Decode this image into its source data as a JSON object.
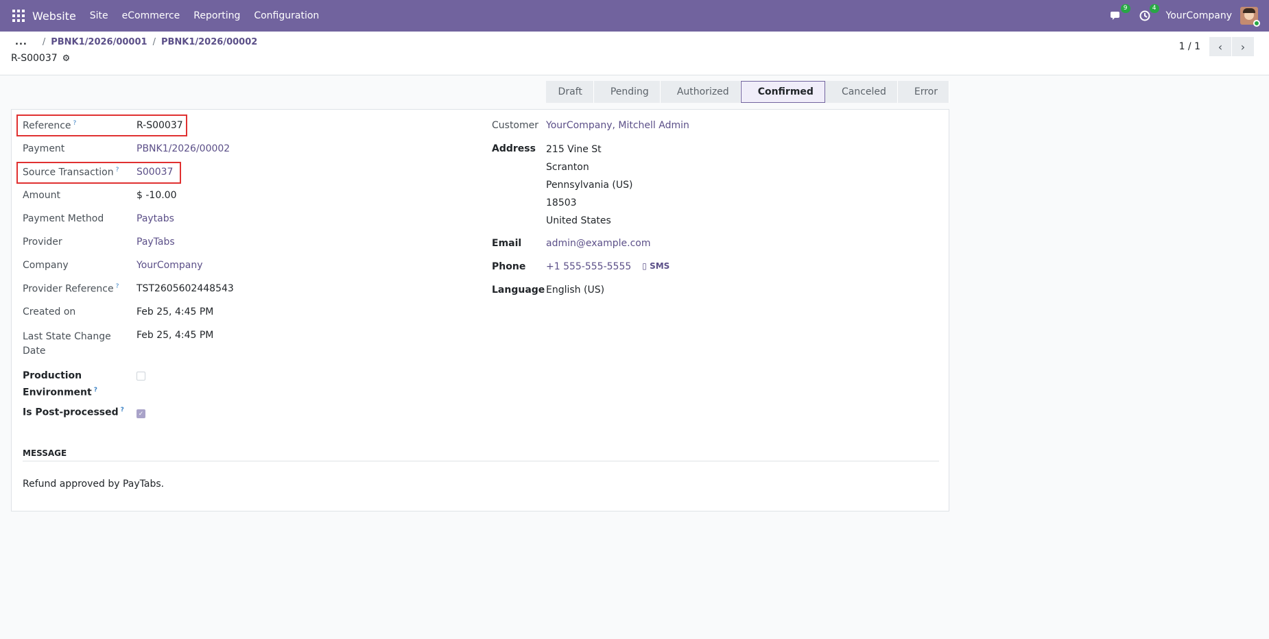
{
  "navbar": {
    "brand": "Website",
    "menu": [
      "Site",
      "eCommerce",
      "Reporting",
      "Configuration"
    ],
    "messages_count": "9",
    "activities_count": "4",
    "company": "YourCompany"
  },
  "breadcrumb": {
    "more": "...",
    "items": [
      "PBNK1/2026/00001",
      "PBNK1/2026/00002"
    ]
  },
  "record_title": "R-S00037",
  "pager": {
    "value": "1 / 1"
  },
  "statusbar": {
    "stages": [
      "Draft",
      "Pending",
      "Authorized",
      "Confirmed",
      "Canceled",
      "Error"
    ],
    "active": "Confirmed"
  },
  "left_fields": {
    "reference": {
      "label": "Reference",
      "value": "R-S00037"
    },
    "payment": {
      "label": "Payment",
      "value": "PBNK1/2026/00002"
    },
    "source_transaction": {
      "label": "Source Transaction",
      "value": "S00037"
    },
    "amount": {
      "label": "Amount",
      "value": "$ -10.00"
    },
    "payment_method": {
      "label": "Payment Method",
      "value": "Paytabs"
    },
    "provider": {
      "label": "Provider",
      "value": "PayTabs"
    },
    "company": {
      "label": "Company",
      "value": "YourCompany"
    },
    "provider_reference": {
      "label": "Provider Reference",
      "value": "TST2605602448543"
    },
    "created_on": {
      "label": "Created on",
      "value": "Feb 25, 4:45 PM"
    },
    "last_state_change": {
      "label_1": "Last State Change",
      "label_2": "Date",
      "value": "Feb 25, 4:45 PM"
    },
    "production_environment": {
      "label_1": "Production",
      "label_2": "Environment",
      "checked": false
    },
    "is_post_processed": {
      "label": "Is Post-processed",
      "checked": true
    }
  },
  "right_fields": {
    "customer": {
      "label": "Customer",
      "value": "YourCompany, Mitchell Admin"
    },
    "address": {
      "label": "Address",
      "lines": [
        "215 Vine St",
        "Scranton",
        "Pennsylvania (US)",
        "18503",
        "United States"
      ]
    },
    "email": {
      "label": "Email",
      "value": "admin@example.com"
    },
    "phone": {
      "label": "Phone",
      "value": "+1 555-555-5555",
      "sms": "SMS"
    },
    "language": {
      "label": "Language",
      "value": "English (US)"
    }
  },
  "message": {
    "heading": "MESSAGE",
    "text": "Refund approved by PayTabs."
  },
  "help_marker": "?",
  "sms_icon_glyph": "▯",
  "checked_glyph": "✓",
  "icons": [
    "apps-grid-icon",
    "chat-icon",
    "clock-icon",
    "gear-icon",
    "chevron-left-icon",
    "chevron-right-icon",
    "mobile-icon"
  ]
}
